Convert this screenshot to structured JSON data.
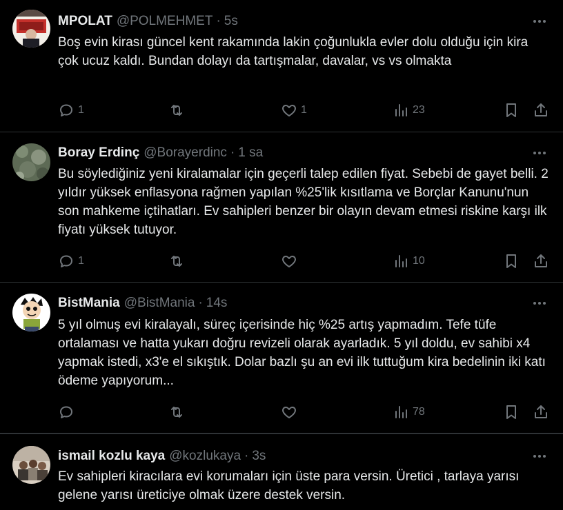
{
  "tweets": [
    {
      "name": "MPOLAT",
      "handle": "@POLMEHMET",
      "time": "5s",
      "text": "Boş evin kirası güncel kent rakamında lakin çoğunlukla evler dolu olduğu için kira çok ucuz kaldı. Bundan dolayı da tartışmalar, davalar,  vs vs olmakta",
      "replies": "1",
      "retweets": "",
      "likes": "1",
      "views": "23"
    },
    {
      "name": "Boray Erdinç",
      "handle": "@Borayerdinc",
      "time": "1 sa",
      "text": "Bu söylediğiniz yeni kiralamalar için geçerli talep edilen fiyat. Sebebi de gayet belli. 2 yıldır yüksek enflasyona rağmen yapılan %25'lik kısıtlama ve Borçlar Kanunu'nun son mahkeme içtihatları. Ev sahipleri benzer bir olayın devam etmesi riskine karşı ilk fiyatı yüksek tutuyor.",
      "replies": "1",
      "retweets": "",
      "likes": "",
      "views": "10"
    },
    {
      "name": "BistMania",
      "handle": "@BistMania",
      "time": "14s",
      "text": "5 yıl olmuş evi kiralayalı, süreç içerisinde hiç %25 artış yapmadım. Tefe tüfe ortalaması ve hatta yukarı doğru revizeli olarak ayarladık. 5 yıl doldu, ev sahibi x4 yapmak istedi, x3'e el sıkıştık. Dolar bazlı şu an evi ilk tuttuğum kira bedelinin iki katı ödeme yapıyorum...",
      "replies": "",
      "retweets": "",
      "likes": "",
      "views": "78"
    },
    {
      "name": "ismail kozlu kaya",
      "handle": "@kozlukaya",
      "time": "3s",
      "text": "Ev sahipleri kiracılara evi korumaları için üste para versin. Üretici , tarlaya yarısı gelene yarısı üreticiye olmak üzere destek versin.",
      "replies": "",
      "retweets": "",
      "likes": "",
      "views": ""
    }
  ],
  "dot": "·"
}
